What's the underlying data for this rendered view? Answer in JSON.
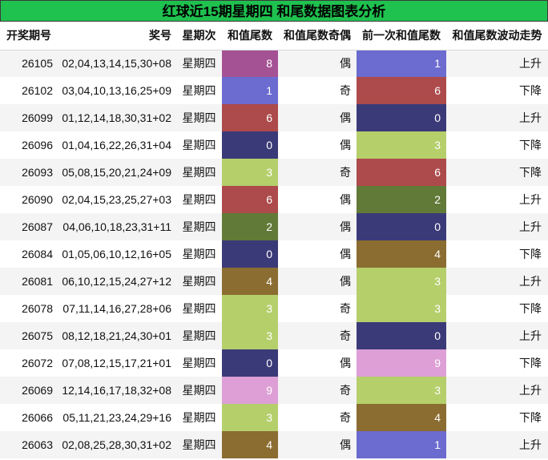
{
  "title": "红球近15期星期四 和尾数据图表分析",
  "headers": {
    "issue": "开奖期号",
    "numbers": "奖号",
    "weekday": "星期次",
    "tail": "和值尾数",
    "parity": "和值尾数奇偶",
    "prev_tail": "前一次和值尾数",
    "trend": "和值尾数波动走势"
  },
  "digit_colors": {
    "0": "#3b3a78",
    "1": "#6b6bd0",
    "2": "#617a38",
    "3": "#b5cf6b",
    "4": "#8b6c31",
    "6": "#ad4a4b",
    "8": "#a55295",
    "9": "#dd9fd5"
  },
  "rows": [
    {
      "issue": "26105",
      "numbers": "02,04,13,14,15,30+08",
      "weekday": "星期四",
      "tail": "8",
      "parity": "偶",
      "prev_tail": "1",
      "trend": "上升"
    },
    {
      "issue": "26102",
      "numbers": "03,04,10,13,16,25+09",
      "weekday": "星期四",
      "tail": "1",
      "parity": "奇",
      "prev_tail": "6",
      "trend": "下降"
    },
    {
      "issue": "26099",
      "numbers": "01,12,14,18,30,31+02",
      "weekday": "星期四",
      "tail": "6",
      "parity": "偶",
      "prev_tail": "0",
      "trend": "上升"
    },
    {
      "issue": "26096",
      "numbers": "01,04,16,22,26,31+04",
      "weekday": "星期四",
      "tail": "0",
      "parity": "偶",
      "prev_tail": "3",
      "trend": "下降"
    },
    {
      "issue": "26093",
      "numbers": "05,08,15,20,21,24+09",
      "weekday": "星期四",
      "tail": "3",
      "parity": "奇",
      "prev_tail": "6",
      "trend": "下降"
    },
    {
      "issue": "26090",
      "numbers": "02,04,15,23,25,27+03",
      "weekday": "星期四",
      "tail": "6",
      "parity": "偶",
      "prev_tail": "2",
      "trend": "上升"
    },
    {
      "issue": "26087",
      "numbers": "04,06,10,18,23,31+11",
      "weekday": "星期四",
      "tail": "2",
      "parity": "偶",
      "prev_tail": "0",
      "trend": "上升"
    },
    {
      "issue": "26084",
      "numbers": "01,05,06,10,12,16+05",
      "weekday": "星期四",
      "tail": "0",
      "parity": "偶",
      "prev_tail": "4",
      "trend": "下降"
    },
    {
      "issue": "26081",
      "numbers": "06,10,12,15,24,27+12",
      "weekday": "星期四",
      "tail": "4",
      "parity": "偶",
      "prev_tail": "3",
      "trend": "上升"
    },
    {
      "issue": "26078",
      "numbers": "07,11,14,16,27,28+06",
      "weekday": "星期四",
      "tail": "3",
      "parity": "奇",
      "prev_tail": "3",
      "trend": "下降"
    },
    {
      "issue": "26075",
      "numbers": "08,12,18,21,24,30+01",
      "weekday": "星期四",
      "tail": "3",
      "parity": "奇",
      "prev_tail": "0",
      "trend": "上升"
    },
    {
      "issue": "26072",
      "numbers": "07,08,12,15,17,21+01",
      "weekday": "星期四",
      "tail": "0",
      "parity": "偶",
      "prev_tail": "9",
      "trend": "下降"
    },
    {
      "issue": "26069",
      "numbers": "12,14,16,17,18,32+08",
      "weekday": "星期四",
      "tail": "9",
      "parity": "奇",
      "prev_tail": "3",
      "trend": "上升"
    },
    {
      "issue": "26066",
      "numbers": "05,11,21,23,24,29+16",
      "weekday": "星期四",
      "tail": "3",
      "parity": "奇",
      "prev_tail": "4",
      "trend": "下降"
    },
    {
      "issue": "26063",
      "numbers": "02,08,25,28,30,31+02",
      "weekday": "星期四",
      "tail": "4",
      "parity": "偶",
      "prev_tail": "1",
      "trend": "上升"
    }
  ]
}
